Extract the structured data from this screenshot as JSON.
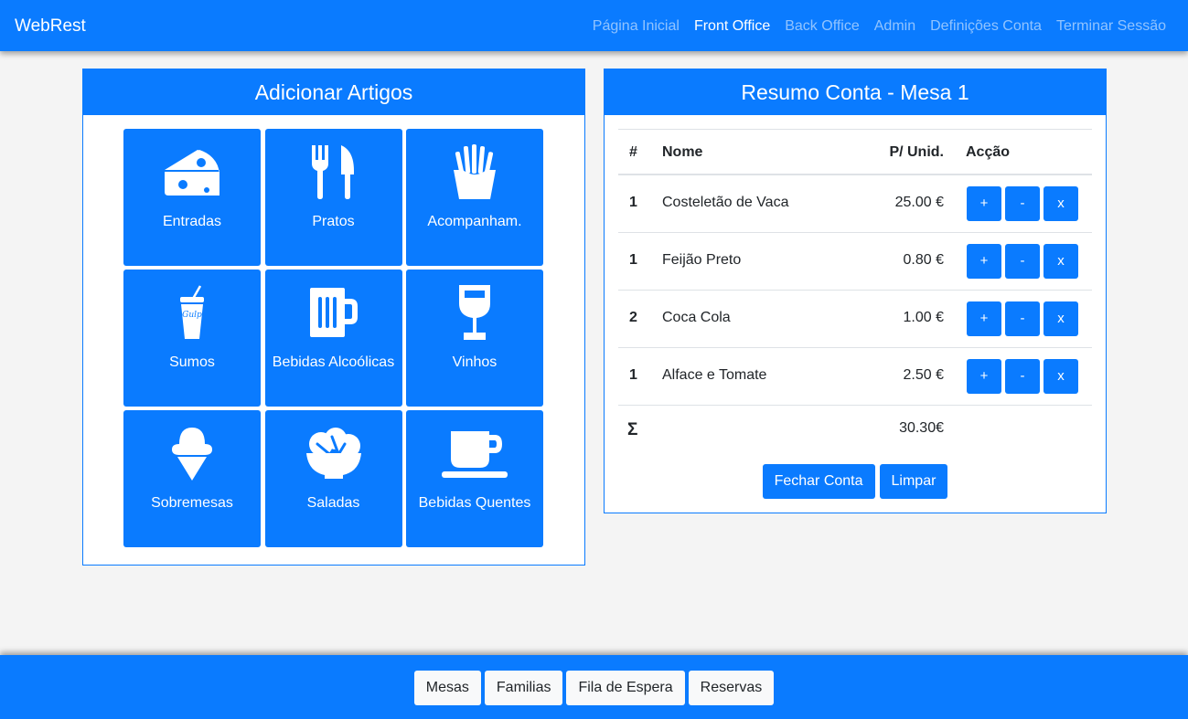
{
  "navbar": {
    "brand": "WebRest",
    "links": [
      {
        "label": "Página Inicial",
        "active": false
      },
      {
        "label": "Front Office",
        "active": true
      },
      {
        "label": "Back Office",
        "active": false
      },
      {
        "label": "Admin",
        "active": false
      },
      {
        "label": "Definições Conta",
        "active": false
      },
      {
        "label": "Terminar Sessão",
        "active": false
      }
    ]
  },
  "add_items": {
    "title": "Adicionar Artigos",
    "categories": [
      {
        "label": "Entradas",
        "icon": "cheese-icon"
      },
      {
        "label": "Pratos",
        "icon": "utensils-icon"
      },
      {
        "label": "Acompanham.",
        "icon": "fries-icon"
      },
      {
        "label": "Sumos",
        "icon": "soda-cup-icon"
      },
      {
        "label": "Bebidas Alcoólicas",
        "icon": "beer-mug-icon"
      },
      {
        "label": "Vinhos",
        "icon": "wine-glass-icon"
      },
      {
        "label": "Sobremesas",
        "icon": "ice-cream-icon"
      },
      {
        "label": "Saladas",
        "icon": "salad-bowl-icon"
      },
      {
        "label": "Bebidas Quentes",
        "icon": "coffee-cup-icon"
      }
    ]
  },
  "bill": {
    "title": "Resumo Conta - Mesa 1",
    "headers": {
      "qty": "#",
      "name": "Nome",
      "price": "P/ Unid.",
      "action": "Acção"
    },
    "rows": [
      {
        "qty": "1",
        "name": "Costeletão de Vaca",
        "price": "25.00 €"
      },
      {
        "qty": "1",
        "name": "Feijão Preto",
        "price": "0.80 €"
      },
      {
        "qty": "2",
        "name": "Coca Cola",
        "price": "1.00 €"
      },
      {
        "qty": "1",
        "name": "Alface e Tomate",
        "price": "2.50 €"
      }
    ],
    "row_actions": {
      "add": "+",
      "remove": "-",
      "delete": "x"
    },
    "total_symbol": "Σ",
    "total": "30.30€",
    "close_button": "Fechar Conta",
    "clear_button": "Limpar"
  },
  "bottom_bar": {
    "buttons": [
      "Mesas",
      "Familias",
      "Fila de Espera",
      "Reservas"
    ]
  },
  "colors": {
    "primary": "#0a7bff",
    "background": "#f4f4f4",
    "light_button": "#f8f9fa"
  }
}
